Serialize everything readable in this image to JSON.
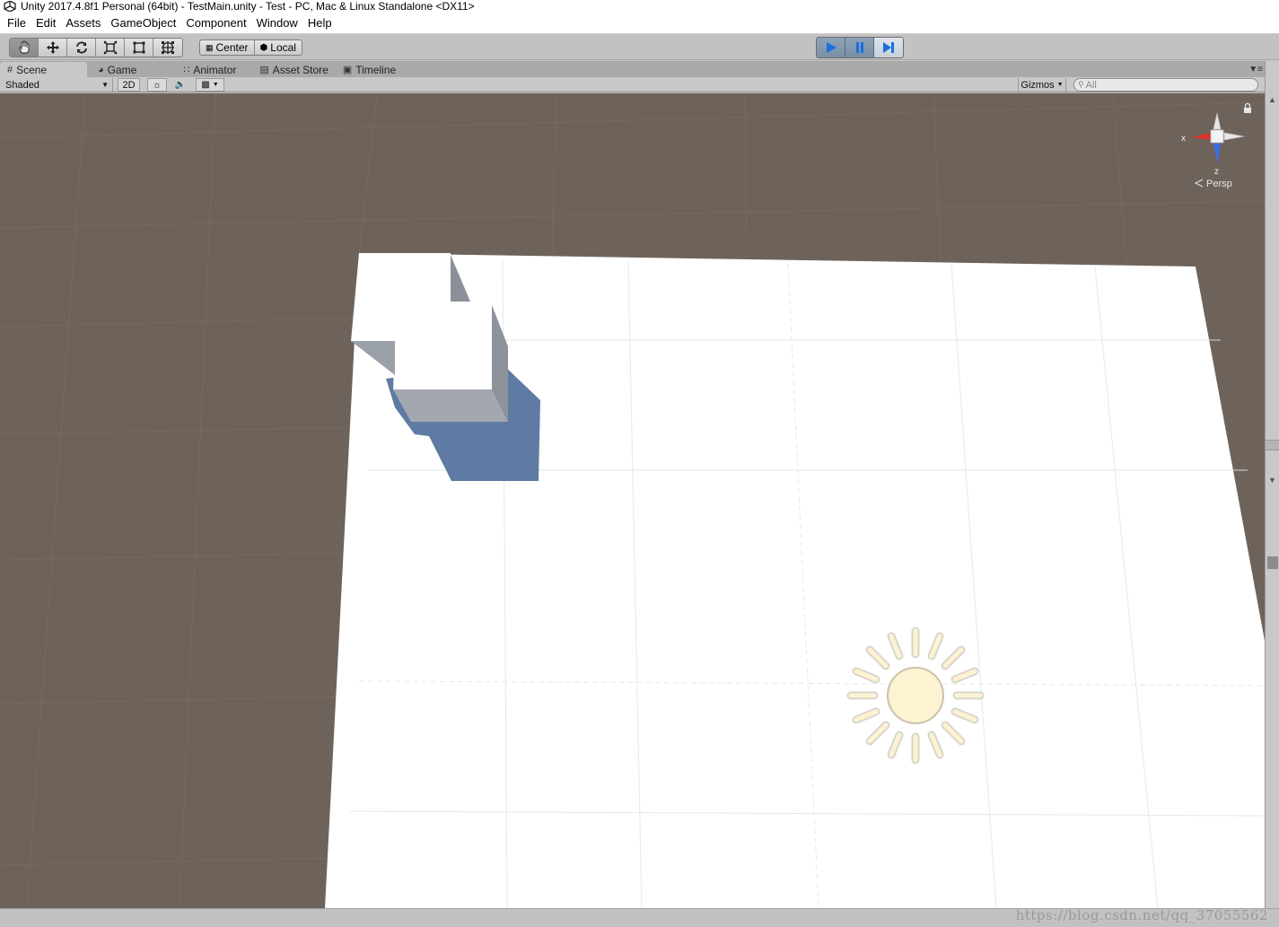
{
  "window": {
    "title": "Unity 2017.4.8f1 Personal (64bit) - TestMain.unity - Test - PC, Mac & Linux Standalone <DX11>"
  },
  "menu": [
    "File",
    "Edit",
    "Assets",
    "GameObject",
    "Component",
    "Window",
    "Help"
  ],
  "toolbar": {
    "transform_tools": [
      "hand-tool",
      "move-tool",
      "rotate-tool",
      "scale-tool",
      "rect-tool",
      "transform-tool"
    ],
    "active_tool": "hand-tool",
    "pivot_mode": "Center",
    "pivot_rotation": "Local"
  },
  "tabs": [
    {
      "label": "Scene",
      "icon": "grid-icon",
      "active": true
    },
    {
      "label": "Game",
      "icon": "pacman-icon",
      "active": false
    },
    {
      "label": "Animator",
      "icon": "animator-icon",
      "active": false
    },
    {
      "label": "Asset Store",
      "icon": "store-icon",
      "active": false
    },
    {
      "label": "Timeline",
      "icon": "timeline-icon",
      "active": false
    }
  ],
  "scene_toolbar": {
    "draw_mode": "Shaded",
    "mode_2d": "2D",
    "gizmos": "Gizmos",
    "search_placeholder": "All"
  },
  "gizmo": {
    "x_label": "x",
    "z_label": "z",
    "projection": "Persp"
  },
  "colors": {
    "background": "#6e635a",
    "plane": "#ffffff",
    "shadow": "#5f7ba3",
    "sun": "#fdf2d2",
    "x_axis": "#d9352a",
    "z_axis": "#3a6fe0"
  },
  "watermark": "https://blog.csdn.net/qq_37055562"
}
